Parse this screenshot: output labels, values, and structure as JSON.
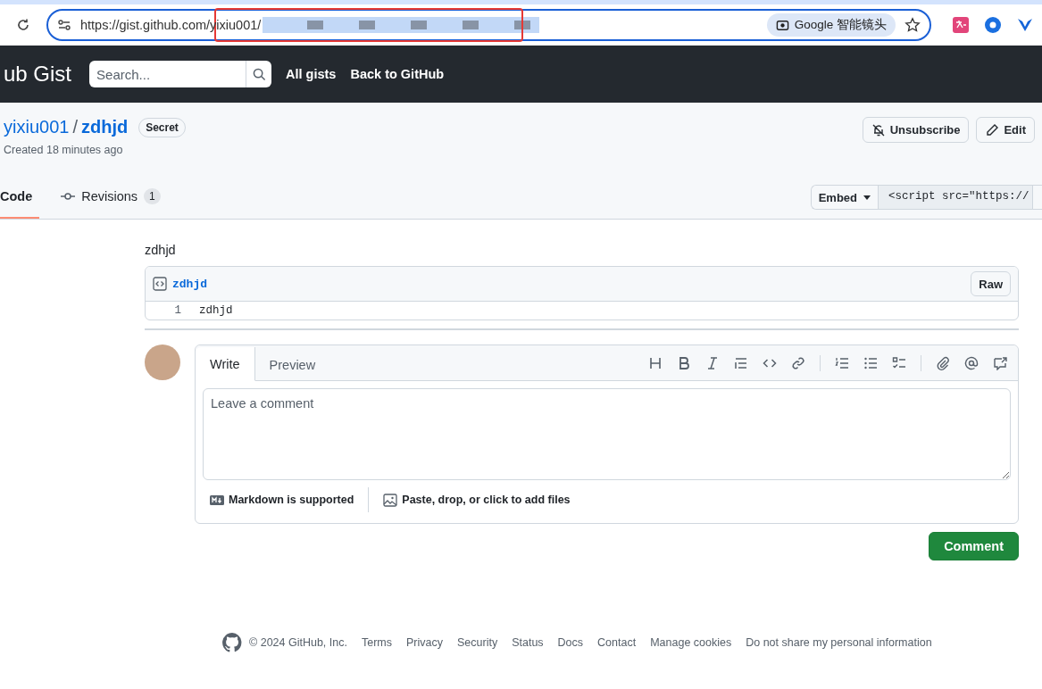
{
  "browser": {
    "url": "https://gist.github.com/yixiu001/",
    "lens_button": "Google 智能镜头"
  },
  "header": {
    "logo": "ub Gist",
    "search_placeholder": "Search...",
    "nav": [
      "All gists",
      "Back to GitHub"
    ]
  },
  "gist": {
    "owner": "yixiu001",
    "separator": "/",
    "name": "zdhjd",
    "badge": "Secret",
    "created": "Created 18 minutes ago",
    "actions": [
      {
        "label": "Unsubscribe",
        "kind": "unsubscribe"
      },
      {
        "label": "Edit",
        "kind": "edit"
      }
    ]
  },
  "tabs": [
    {
      "label": "Code",
      "selected": true
    },
    {
      "label": "Revisions",
      "count": "1",
      "selected": false
    }
  ],
  "embed": {
    "label": "Embed",
    "code": "<script src=\"https://"
  },
  "description": "zdhjd",
  "file": {
    "name": "zdhjd",
    "raw": "Raw",
    "lines": [
      {
        "number": "1",
        "code": "zdhjd"
      }
    ]
  },
  "comment": {
    "tabs": [
      {
        "label": "Write",
        "selected": true
      },
      {
        "label": "Preview",
        "selected": false
      }
    ],
    "placeholder": "Leave a comment",
    "markdown_note": "Markdown is supported",
    "attach_note": "Paste, drop, or click to add files",
    "submit": "Comment"
  },
  "footer": {
    "copyright": "© 2024 GitHub, Inc.",
    "links": [
      "Terms",
      "Privacy",
      "Security",
      "Status",
      "Docs",
      "Contact",
      "Manage cookies",
      "Do not share my personal information"
    ]
  }
}
